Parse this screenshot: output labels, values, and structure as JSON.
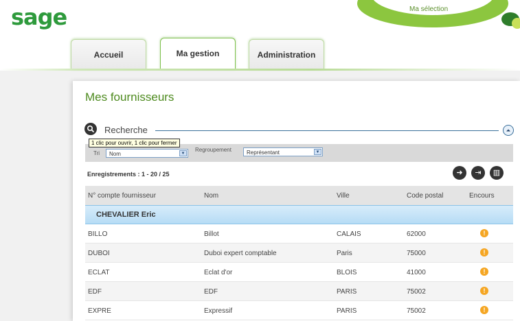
{
  "brand": {
    "logo_text": "sage",
    "selection_label": "Ma sélection"
  },
  "tabs": [
    {
      "label": "Accueil",
      "active": false
    },
    {
      "label": "Ma gestion",
      "active": true
    },
    {
      "label": "Administration",
      "active": false
    }
  ],
  "page": {
    "title": "Mes fournisseurs"
  },
  "search": {
    "label": "Recherche",
    "tooltip": "1 clic pour ouvrir, 1 clic pour fermer",
    "sort_label": "Tri",
    "sort_value": "Nom",
    "group_label": "Regroupement",
    "group_value": "Représentant"
  },
  "records": {
    "text": "Enregistrements : 1 - 20 / 25"
  },
  "pager": {
    "next_icon": "arrow-right-icon",
    "last_icon": "arrow-last-icon",
    "columns_icon": "columns-icon"
  },
  "table": {
    "headers": [
      "N° compte fournisseur",
      "Nom",
      "Ville",
      "Code postal",
      "Encours"
    ],
    "group": "CHEVALIER Eric",
    "rows": [
      {
        "code": "BILLO",
        "name": "Billot",
        "city": "CALAIS",
        "zip": "62000"
      },
      {
        "code": "DUBOI",
        "name": "Duboi expert comptable",
        "city": "Paris",
        "zip": "75000"
      },
      {
        "code": "ECLAT",
        "name": "Eclat d'or",
        "city": "BLOIS",
        "zip": "41000"
      },
      {
        "code": "EDF",
        "name": "EDF",
        "city": "PARIS",
        "zip": "75002"
      },
      {
        "code": "EXPRE",
        "name": "Expressif",
        "city": "PARIS",
        "zip": "75002"
      }
    ]
  },
  "colors": {
    "brand_green": "#2e9a3c",
    "title_green": "#4d8a1e",
    "warning": "#f5a623",
    "group_blue": "#b6dcf5"
  }
}
